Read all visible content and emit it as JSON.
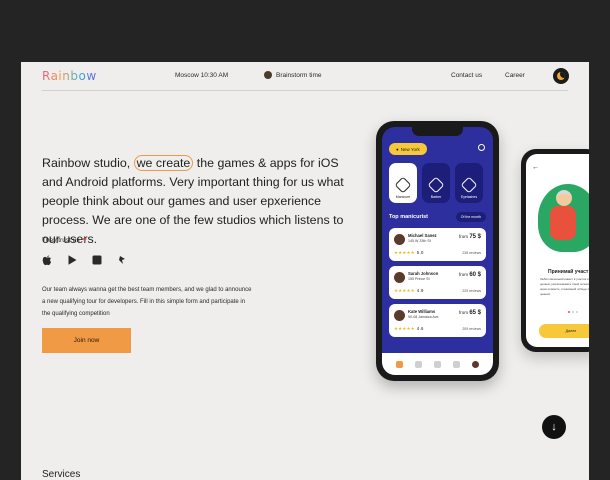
{
  "header": {
    "logo": "Rainbow",
    "time": "Moscow 10:30 AM",
    "brainstorm": "Brainstorm time",
    "contact": "Contact us",
    "career": "Career"
  },
  "hero": {
    "before": "Rainbow studio, ",
    "highlight": "we create",
    "after": " the games & apps for iOS and Android platforms. Very important thing for us what people think about our games and user epxerience process. We are one of the few studios which listens to our users."
  },
  "trust": {
    "label": "They trust us"
  },
  "brands": [
    "apple-icon",
    "google-play-icon",
    "square-icon",
    "bird-icon"
  ],
  "description": "Our team always wanna get the best team members, and we glad to announce a new qualifying tour for developers. Fill in this simple form and participate in the qualifying competition",
  "join_label": "Join now",
  "services_label": "Services",
  "colors": {
    "accent": "#f19a45",
    "background": "#efeeec",
    "phone_screen": "#2e2f9e",
    "chip": "#f6c83a"
  },
  "phone": {
    "location": "New York",
    "categories": [
      {
        "label": "Manicure",
        "active": true
      },
      {
        "label": "Barber",
        "active": false
      },
      {
        "label": "Eyelashes",
        "active": false
      }
    ],
    "top_title": "Top manicurist",
    "filter": "Of the month",
    "cards": [
      {
        "name": "Michael Sanez",
        "address": "145 W 33th St",
        "price_prefix": "from",
        "price": "75 $",
        "stars": "★★★★★",
        "rating": "5.0",
        "reviews": "238 reviews"
      },
      {
        "name": "Sarah Johnson",
        "address": "155 Prince St",
        "price_prefix": "from",
        "price": "60 $",
        "stars": "★★★★★",
        "rating": "4.9",
        "reviews": "229 reviews"
      },
      {
        "name": "Kate Williams",
        "address": "90-08 Jamaica Ave",
        "price_prefix": "from",
        "price": "65 $",
        "stars": "★★★★★",
        "rating": "4.6",
        "reviews": "209 reviews"
      }
    ]
  },
  "phone2": {
    "title": "Принимай участ",
    "text": "Любил маленький инвест в участие в проектах, делаем, реализовывать такой полезный экен нерез в вместе, и вниманий победы полечной ценный",
    "button": "Далее"
  }
}
